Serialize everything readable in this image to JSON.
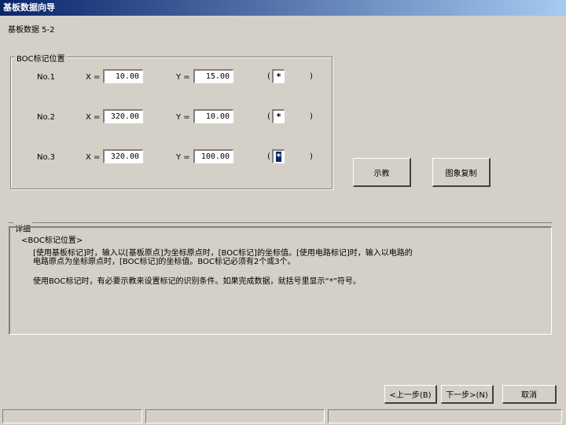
{
  "window": {
    "title": "基板数据向导"
  },
  "page": {
    "subtitle": "基板数据 5-2"
  },
  "boc_group": {
    "legend": "BOC标记位置",
    "x_label": "X =",
    "y_label": "Y =",
    "paren_open": "(",
    "paren_close": ")",
    "rows": [
      {
        "label": "No.1",
        "x": "10.00",
        "y": "15.00",
        "mark": "*"
      },
      {
        "label": "No.2",
        "x": "320.00",
        "y": "10.00",
        "mark": "*"
      },
      {
        "label": "No.3",
        "x": "320.00",
        "y": "100.00",
        "mark": "*"
      }
    ]
  },
  "buttons": {
    "teach": "示教",
    "image_copy": "图象复制",
    "back": "<上一步(B)",
    "next": "下一步>(N)",
    "cancel": "取消"
  },
  "detail": {
    "legend": "详细",
    "heading": "<BOC标记位置>",
    "lines": [
      "[使用基板标记]时，输入以[基板原点]为坐标原点时，[BOC标记]的坐标值。[使用电路标记]时，输入以电路的",
      "电路原点为坐标原点时，[BOC标记]的坐标值。BOC标记必须有2个或3个。",
      "使用BOC标记时，有必要示教来设置标记的识别条件。如果完成数据，就括号里显示“*”符号。"
    ]
  }
}
